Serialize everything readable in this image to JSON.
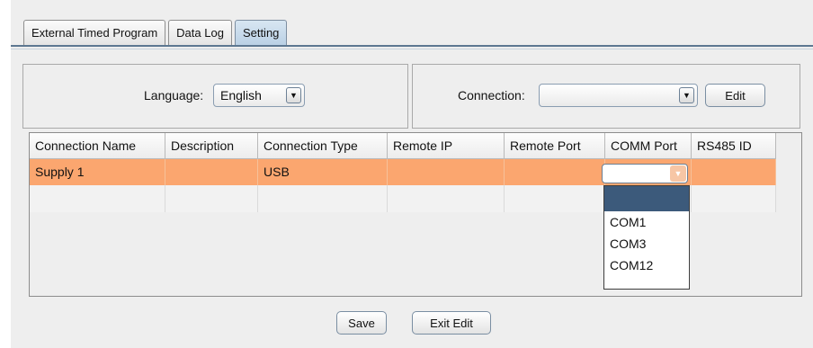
{
  "tabs": [
    {
      "label": "External Timed Program",
      "active": false
    },
    {
      "label": "Data Log",
      "active": false
    },
    {
      "label": "Setting",
      "active": true
    }
  ],
  "language": {
    "label": "Language:",
    "value": "English"
  },
  "connection": {
    "label": "Connection:",
    "value": "",
    "edit_label": "Edit"
  },
  "table": {
    "columns": [
      "Connection Name",
      "Description",
      "Connection Type",
      "Remote IP",
      "Remote Port",
      "COMM Port",
      "RS485 ID"
    ],
    "rows": [
      {
        "name": "Supply 1",
        "description": "",
        "type": "USB",
        "remote_ip": "",
        "remote_port": "",
        "comm_port": "",
        "rs485_id": "",
        "selected": true
      },
      {
        "name": "",
        "description": "",
        "type": "",
        "remote_ip": "",
        "remote_port": "",
        "comm_port": "",
        "rs485_id": "",
        "selected": false
      }
    ]
  },
  "comm_dropdown": {
    "options": [
      "",
      "COM1",
      "COM3",
      "COM12"
    ],
    "highlighted_index": 0
  },
  "footer": {
    "save_label": "Save",
    "exit_edit_label": "Exit Edit"
  },
  "colors": {
    "selected_row": "#fba66f",
    "tab_active": "#b8cfe4",
    "highlight": "#3c5a7b"
  },
  "icons": {
    "dropdown_arrow": "chevron-down-icon"
  }
}
